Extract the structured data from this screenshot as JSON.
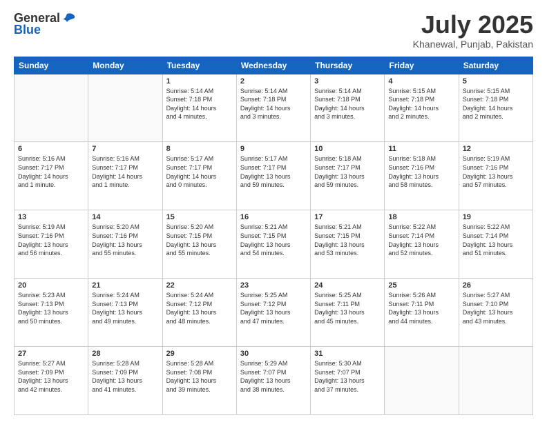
{
  "header": {
    "logo_line1": "General",
    "logo_line2": "Blue",
    "month": "July 2025",
    "location": "Khanewal, Punjab, Pakistan"
  },
  "weekdays": [
    "Sunday",
    "Monday",
    "Tuesday",
    "Wednesday",
    "Thursday",
    "Friday",
    "Saturday"
  ],
  "weeks": [
    [
      {
        "day": "",
        "info": ""
      },
      {
        "day": "",
        "info": ""
      },
      {
        "day": "1",
        "info": "Sunrise: 5:14 AM\nSunset: 7:18 PM\nDaylight: 14 hours\nand 4 minutes."
      },
      {
        "day": "2",
        "info": "Sunrise: 5:14 AM\nSunset: 7:18 PM\nDaylight: 14 hours\nand 3 minutes."
      },
      {
        "day": "3",
        "info": "Sunrise: 5:14 AM\nSunset: 7:18 PM\nDaylight: 14 hours\nand 3 minutes."
      },
      {
        "day": "4",
        "info": "Sunrise: 5:15 AM\nSunset: 7:18 PM\nDaylight: 14 hours\nand 2 minutes."
      },
      {
        "day": "5",
        "info": "Sunrise: 5:15 AM\nSunset: 7:18 PM\nDaylight: 14 hours\nand 2 minutes."
      }
    ],
    [
      {
        "day": "6",
        "info": "Sunrise: 5:16 AM\nSunset: 7:17 PM\nDaylight: 14 hours\nand 1 minute."
      },
      {
        "day": "7",
        "info": "Sunrise: 5:16 AM\nSunset: 7:17 PM\nDaylight: 14 hours\nand 1 minute."
      },
      {
        "day": "8",
        "info": "Sunrise: 5:17 AM\nSunset: 7:17 PM\nDaylight: 14 hours\nand 0 minutes."
      },
      {
        "day": "9",
        "info": "Sunrise: 5:17 AM\nSunset: 7:17 PM\nDaylight: 13 hours\nand 59 minutes."
      },
      {
        "day": "10",
        "info": "Sunrise: 5:18 AM\nSunset: 7:17 PM\nDaylight: 13 hours\nand 59 minutes."
      },
      {
        "day": "11",
        "info": "Sunrise: 5:18 AM\nSunset: 7:16 PM\nDaylight: 13 hours\nand 58 minutes."
      },
      {
        "day": "12",
        "info": "Sunrise: 5:19 AM\nSunset: 7:16 PM\nDaylight: 13 hours\nand 57 minutes."
      }
    ],
    [
      {
        "day": "13",
        "info": "Sunrise: 5:19 AM\nSunset: 7:16 PM\nDaylight: 13 hours\nand 56 minutes."
      },
      {
        "day": "14",
        "info": "Sunrise: 5:20 AM\nSunset: 7:16 PM\nDaylight: 13 hours\nand 55 minutes."
      },
      {
        "day": "15",
        "info": "Sunrise: 5:20 AM\nSunset: 7:15 PM\nDaylight: 13 hours\nand 55 minutes."
      },
      {
        "day": "16",
        "info": "Sunrise: 5:21 AM\nSunset: 7:15 PM\nDaylight: 13 hours\nand 54 minutes."
      },
      {
        "day": "17",
        "info": "Sunrise: 5:21 AM\nSunset: 7:15 PM\nDaylight: 13 hours\nand 53 minutes."
      },
      {
        "day": "18",
        "info": "Sunrise: 5:22 AM\nSunset: 7:14 PM\nDaylight: 13 hours\nand 52 minutes."
      },
      {
        "day": "19",
        "info": "Sunrise: 5:22 AM\nSunset: 7:14 PM\nDaylight: 13 hours\nand 51 minutes."
      }
    ],
    [
      {
        "day": "20",
        "info": "Sunrise: 5:23 AM\nSunset: 7:13 PM\nDaylight: 13 hours\nand 50 minutes."
      },
      {
        "day": "21",
        "info": "Sunrise: 5:24 AM\nSunset: 7:13 PM\nDaylight: 13 hours\nand 49 minutes."
      },
      {
        "day": "22",
        "info": "Sunrise: 5:24 AM\nSunset: 7:12 PM\nDaylight: 13 hours\nand 48 minutes."
      },
      {
        "day": "23",
        "info": "Sunrise: 5:25 AM\nSunset: 7:12 PM\nDaylight: 13 hours\nand 47 minutes."
      },
      {
        "day": "24",
        "info": "Sunrise: 5:25 AM\nSunset: 7:11 PM\nDaylight: 13 hours\nand 45 minutes."
      },
      {
        "day": "25",
        "info": "Sunrise: 5:26 AM\nSunset: 7:11 PM\nDaylight: 13 hours\nand 44 minutes."
      },
      {
        "day": "26",
        "info": "Sunrise: 5:27 AM\nSunset: 7:10 PM\nDaylight: 13 hours\nand 43 minutes."
      }
    ],
    [
      {
        "day": "27",
        "info": "Sunrise: 5:27 AM\nSunset: 7:09 PM\nDaylight: 13 hours\nand 42 minutes."
      },
      {
        "day": "28",
        "info": "Sunrise: 5:28 AM\nSunset: 7:09 PM\nDaylight: 13 hours\nand 41 minutes."
      },
      {
        "day": "29",
        "info": "Sunrise: 5:28 AM\nSunset: 7:08 PM\nDaylight: 13 hours\nand 39 minutes."
      },
      {
        "day": "30",
        "info": "Sunrise: 5:29 AM\nSunset: 7:07 PM\nDaylight: 13 hours\nand 38 minutes."
      },
      {
        "day": "31",
        "info": "Sunrise: 5:30 AM\nSunset: 7:07 PM\nDaylight: 13 hours\nand 37 minutes."
      },
      {
        "day": "",
        "info": ""
      },
      {
        "day": "",
        "info": ""
      }
    ]
  ]
}
